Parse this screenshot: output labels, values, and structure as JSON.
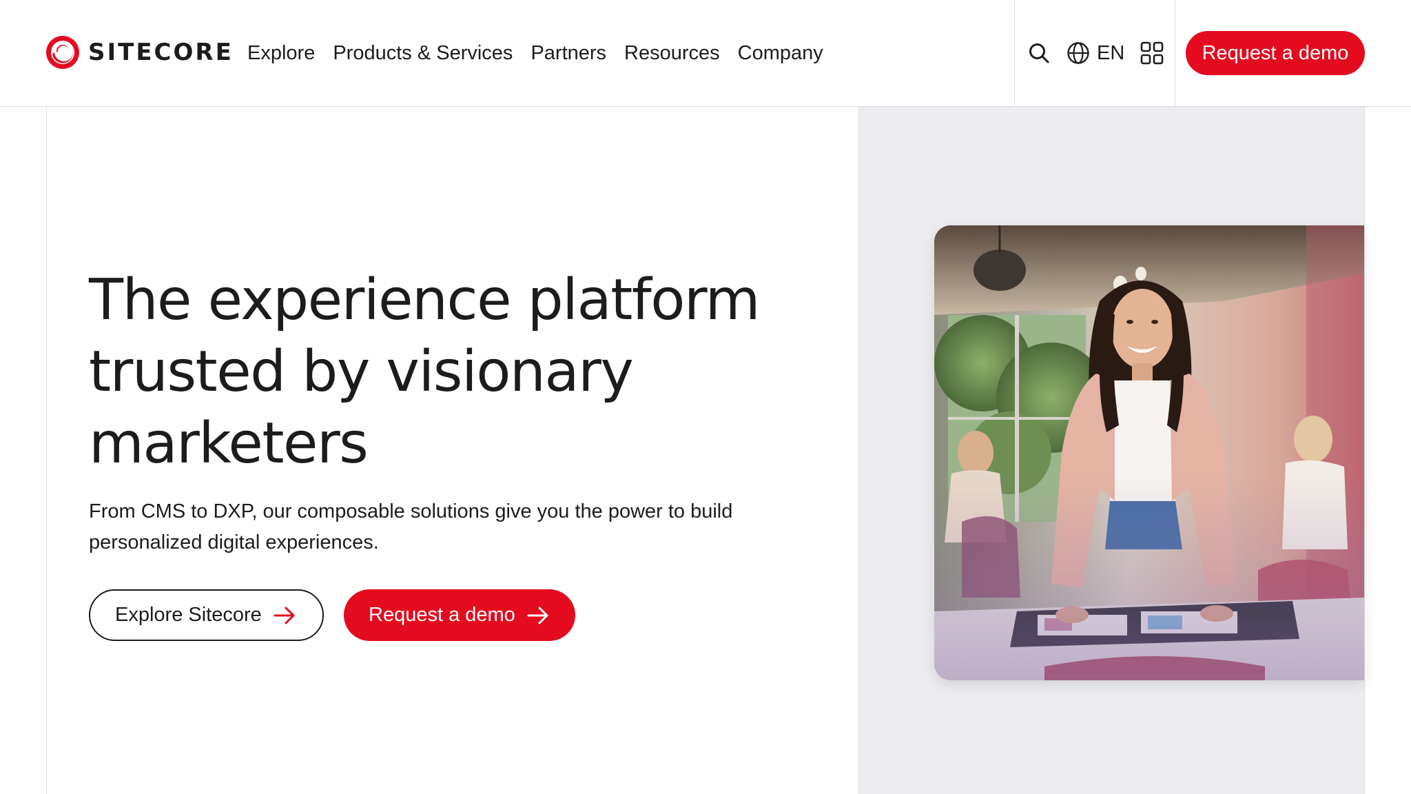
{
  "brand": {
    "name": "SITECORE",
    "accent_color": "#e40b1f",
    "text_color": "#1c1c1c",
    "panel_color": "#ececf0"
  },
  "nav": {
    "items": [
      {
        "label": "Explore"
      },
      {
        "label": "Products & Services"
      },
      {
        "label": "Partners"
      },
      {
        "label": "Resources"
      },
      {
        "label": "Company"
      }
    ]
  },
  "header_tools": {
    "search_icon": "search-icon",
    "language_icon": "globe-icon",
    "language_label": "EN",
    "apps_icon": "grid-icon",
    "demo_button_label": "Request a demo"
  },
  "hero": {
    "headline": "The experience platform trusted by visionary marketers",
    "subtext": "From CMS to DXP, our composable solutions give you the power to build personalized digital experiences.",
    "primary_cta": {
      "label": "Explore Sitecore",
      "icon": "arrow-right-icon"
    },
    "secondary_cta": {
      "label": "Request a demo",
      "icon": "arrow-right-icon"
    },
    "image": {
      "description_icon": "hero-photo"
    }
  }
}
